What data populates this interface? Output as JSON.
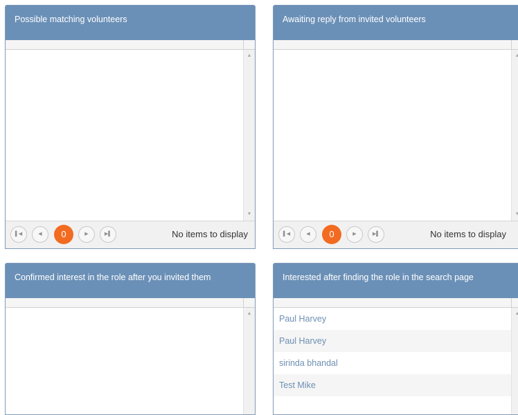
{
  "panels": {
    "matching": {
      "title": "Possible matching volunteers",
      "pager": {
        "current_page": "0",
        "status": "No items to display",
        "first_icon": "pager-first-icon",
        "prev_icon": "pager-prev-icon",
        "next_icon": "pager-next-icon",
        "last_icon": "pager-last-icon"
      }
    },
    "awaiting": {
      "title": "Awaiting reply from invited volunteers",
      "pager": {
        "current_page": "0",
        "status": "No items to display",
        "first_icon": "pager-first-icon",
        "prev_icon": "pager-prev-icon",
        "next_icon": "pager-next-icon",
        "last_icon": "pager-last-icon"
      }
    },
    "confirmed": {
      "title": "Confirmed interest in the role after you invited them"
    },
    "interested": {
      "title": "Interested after finding the role in the search page",
      "rows": [
        "Paul Harvey",
        "Paul Harvey",
        "sirinda bhandal",
        "Test Mike"
      ]
    }
  },
  "colors": {
    "header_bg": "#6b90b7",
    "pager_active": "#f26b21",
    "link_text": "#6d8fb3"
  }
}
